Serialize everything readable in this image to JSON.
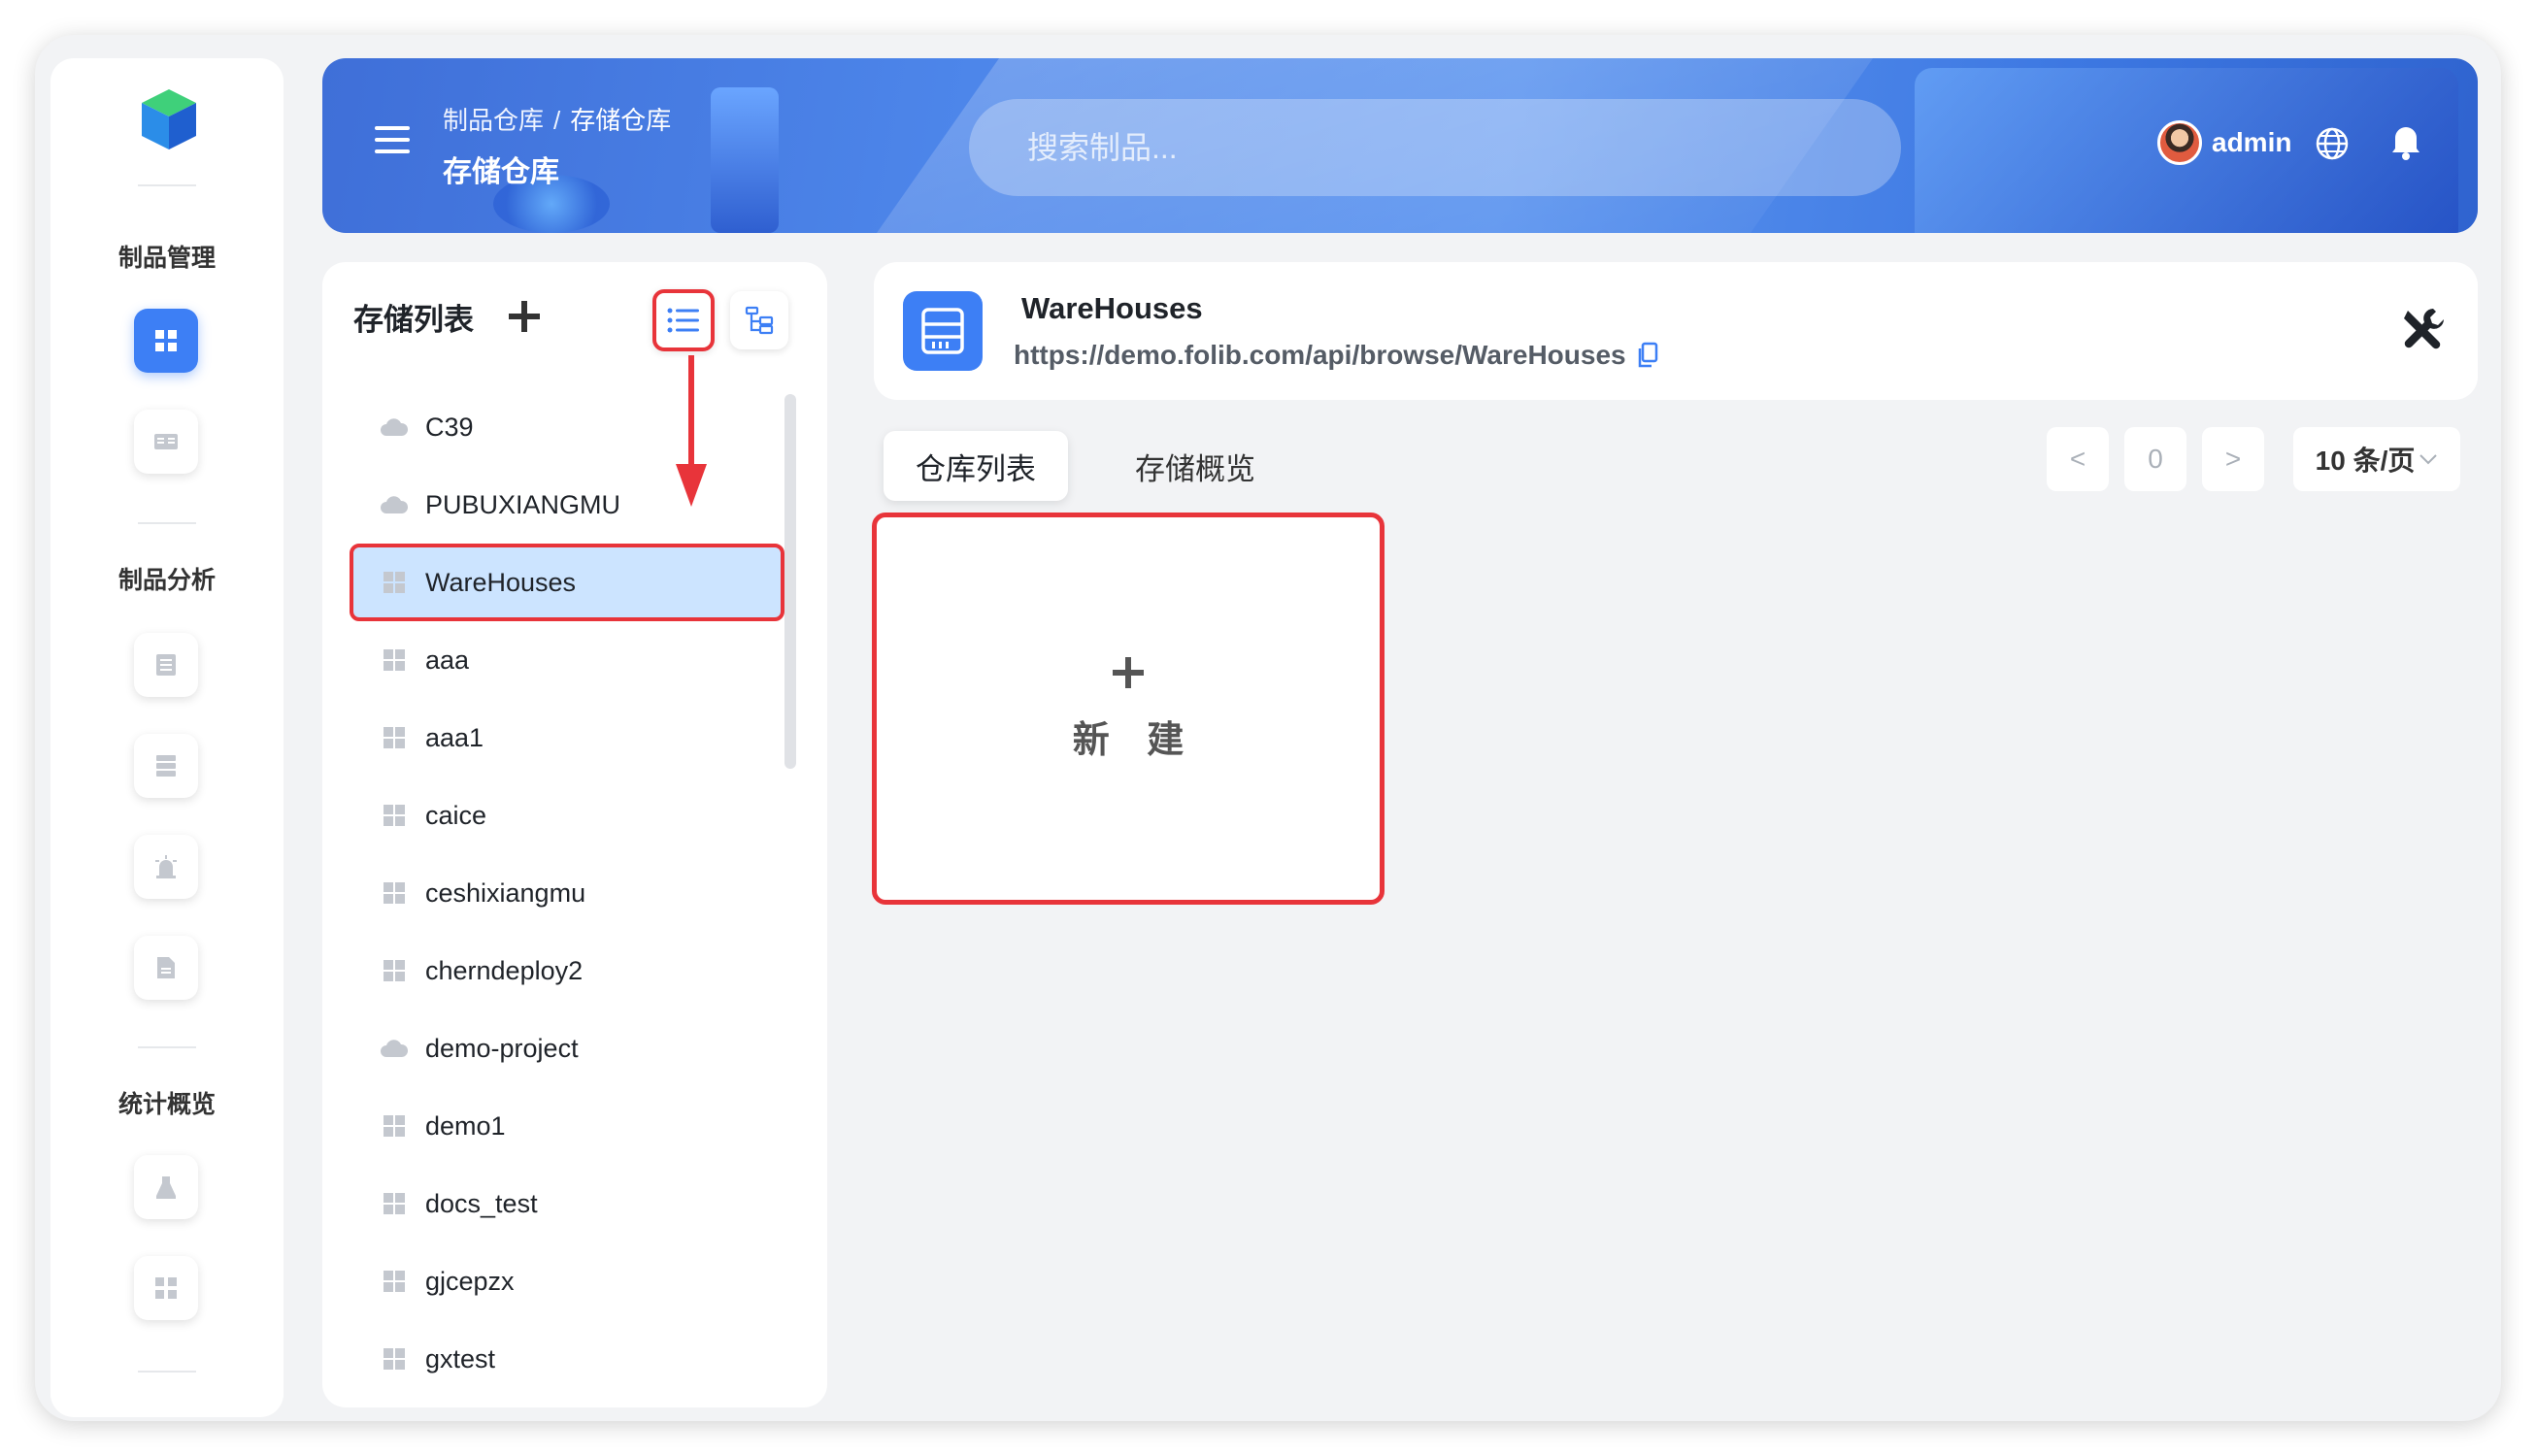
{
  "header": {
    "breadcrumb": [
      "制品仓库",
      "存储仓库"
    ],
    "breadcrumb_sep": "/",
    "title": "存储仓库",
    "search_placeholder": "搜索制品...",
    "username": "admin"
  },
  "sidebar": {
    "sections": [
      {
        "title": "制品管理",
        "items": [
          "dashboard-icon",
          "book-icon"
        ]
      },
      {
        "title": "制品分析",
        "items": [
          "list-doc-icon",
          "server-icon",
          "alarm-icon",
          "file-icon"
        ]
      },
      {
        "title": "统计概览",
        "items": [
          "flask-icon",
          "grid-icon"
        ]
      }
    ],
    "active_item": "dashboard-icon"
  },
  "storage_list": {
    "title": "存储列表",
    "items": [
      {
        "name": "C39",
        "icon": "cloud"
      },
      {
        "name": "PUBUXIANGMU",
        "icon": "cloud"
      },
      {
        "name": "WareHouses",
        "icon": "grid",
        "selected": true
      },
      {
        "name": "aaa",
        "icon": "grid"
      },
      {
        "name": "aaa1",
        "icon": "grid"
      },
      {
        "name": "caice",
        "icon": "grid"
      },
      {
        "name": "ceshixiangmu",
        "icon": "grid"
      },
      {
        "name": "cherndeploy2",
        "icon": "grid"
      },
      {
        "name": "demo-project",
        "icon": "cloud"
      },
      {
        "name": "demo1",
        "icon": "grid"
      },
      {
        "name": "docs_test",
        "icon": "grid"
      },
      {
        "name": "gjcepzx",
        "icon": "grid"
      },
      {
        "name": "gxtest",
        "icon": "grid"
      }
    ]
  },
  "storage_info": {
    "name": "WareHouses",
    "url": "https://demo.folib.com/api/browse/WareHouses"
  },
  "tabs": [
    "仓库列表",
    "存储概览"
  ],
  "pager": {
    "prev": "<",
    "page": "0",
    "next": ">",
    "page_size": "10 条/页"
  },
  "new_card": {
    "label": "新 建"
  },
  "colors": {
    "accent": "#3d7ff5",
    "highlight": "#e8343a",
    "selected_bg": "#cce4ff"
  }
}
